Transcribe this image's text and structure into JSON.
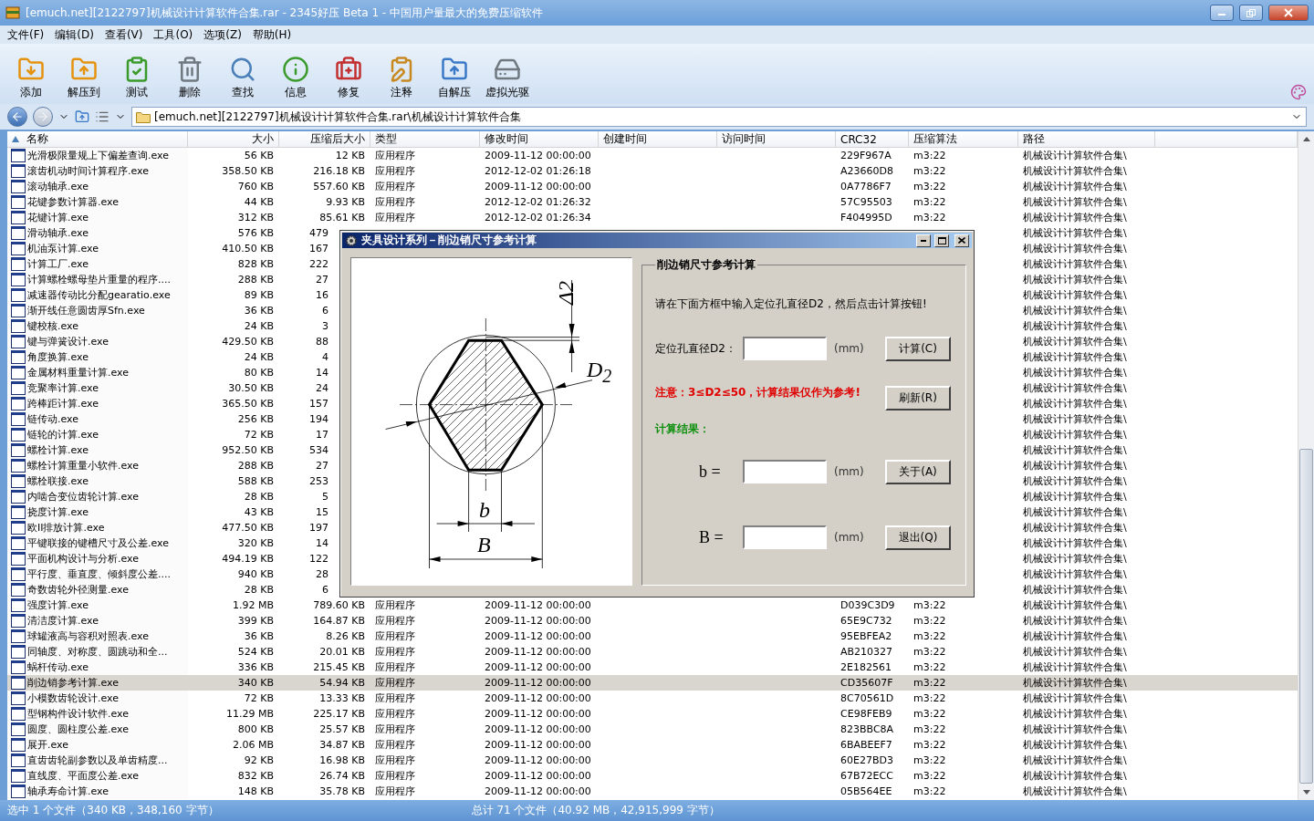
{
  "window": {
    "title": "[emuch.net][2122797]机械设计计算软件合集.rar - 2345好压 Beta 1 - 中国用户量最大的免费压缩软件"
  },
  "menu": [
    "文件(F)",
    "编辑(D)",
    "查看(V)",
    "工具(O)",
    "选项(Z)",
    "帮助(H)"
  ],
  "toolbar": [
    {
      "label": "添加",
      "kind": "add"
    },
    {
      "label": "解压到",
      "kind": "extract"
    },
    {
      "label": "测试",
      "kind": "test"
    },
    {
      "label": "删除",
      "kind": "delete"
    },
    {
      "label": "查找",
      "kind": "find"
    },
    {
      "label": "信息",
      "kind": "info"
    },
    {
      "label": "修复",
      "kind": "repair"
    },
    {
      "label": "注释",
      "kind": "comment"
    },
    {
      "label": "自解压",
      "kind": "sfx"
    },
    {
      "label": "虚拟光驱",
      "kind": "drive"
    }
  ],
  "address": {
    "path": "[emuch.net][2122797]机械设计计算软件合集.rar\\机械设计计算软件合集",
    "forward_disabled": true
  },
  "table": {
    "columns": [
      {
        "label": "名称",
        "sorted": true
      },
      {
        "label": "大小",
        "sorted": false
      },
      {
        "label": "压缩后大小",
        "sorted": false
      },
      {
        "label": "类型",
        "sorted": false
      },
      {
        "label": "修改时间",
        "sorted": false
      },
      {
        "label": "创建时间",
        "sorted": false
      },
      {
        "label": "访问时间",
        "sorted": false
      },
      {
        "label": "CRC32",
        "sorted": false
      },
      {
        "label": "压缩算法",
        "sorted": false
      },
      {
        "label": "路径",
        "sorted": false
      }
    ],
    "rows": [
      {
        "name": "光滑极限量规上下偏差查询.exe",
        "size": "56 KB",
        "compressed": "12 KB",
        "type": "应用程序",
        "modified": "2009-11-12 00:00:00",
        "crc": "229F967A",
        "method": "m3:22",
        "path": "机械设计计算软件合集\\",
        "selected": false
      },
      {
        "name": "滚齿机动时间计算程序.exe",
        "size": "358.50 KB",
        "compressed": "216.18 KB",
        "type": "应用程序",
        "modified": "2012-12-02 01:26:18",
        "crc": "A23660D8",
        "method": "m3:22",
        "path": "机械设计计算软件合集\\",
        "selected": false
      },
      {
        "name": "滚动轴承.exe",
        "size": "760 KB",
        "compressed": "557.60 KB",
        "type": "应用程序",
        "modified": "2009-11-12 00:00:00",
        "crc": "0A7786F7",
        "method": "m3:22",
        "path": "机械设计计算软件合集\\",
        "selected": false
      },
      {
        "name": "花键参数计算器.exe",
        "size": "44 KB",
        "compressed": "9.93 KB",
        "type": "应用程序",
        "modified": "2012-12-02 01:26:32",
        "crc": "57C95503",
        "method": "m3:22",
        "path": "机械设计计算软件合集\\",
        "selected": false
      },
      {
        "name": "花键计算.exe",
        "size": "312 KB",
        "compressed": "85.61 KB",
        "type": "应用程序",
        "modified": "2012-12-02 01:26:34",
        "crc": "F404995D",
        "method": "m3:22",
        "path": "机械设计计算软件合集\\",
        "selected": false
      },
      {
        "name": "滑动轴承.exe",
        "size": "576 KB",
        "compressed": "479",
        "path": "机械设计计算软件合集\\",
        "selected": false
      },
      {
        "name": "机油泵计算.exe",
        "size": "410.50 KB",
        "compressed": "167",
        "path": "机械设计计算软件合集\\",
        "selected": false
      },
      {
        "name": "计算工厂.exe",
        "size": "828 KB",
        "compressed": "222",
        "path": "机械设计计算软件合集\\",
        "selected": false
      },
      {
        "name": "计算螺栓螺母垫片重量的程序....",
        "size": "288 KB",
        "compressed": "27",
        "path": "机械设计计算软件合集\\",
        "selected": false
      },
      {
        "name": "减速器传动比分配gearatio.exe",
        "size": "89 KB",
        "compressed": "16",
        "path": "机械设计计算软件合集\\",
        "selected": false
      },
      {
        "name": "渐开线任意圆齿厚Sfn.exe",
        "size": "36 KB",
        "compressed": "6",
        "path": "机械设计计算软件合集\\",
        "selected": false
      },
      {
        "name": "键校核.exe",
        "size": "24 KB",
        "compressed": "3",
        "path": "机械设计计算软件合集\\",
        "selected": false
      },
      {
        "name": "键与弹簧设计.exe",
        "size": "429.50 KB",
        "compressed": "88",
        "path": "机械设计计算软件合集\\",
        "selected": false
      },
      {
        "name": "角度换算.exe",
        "size": "24 KB",
        "compressed": "4",
        "path": "机械设计计算软件合集\\",
        "selected": false
      },
      {
        "name": "金属材料重量计算.exe",
        "size": "80 KB",
        "compressed": "14",
        "path": "机械设计计算软件合集\\",
        "selected": false
      },
      {
        "name": "竞聚率计算.exe",
        "size": "30.50 KB",
        "compressed": "24",
        "path": "机械设计计算软件合集\\",
        "selected": false
      },
      {
        "name": "跨棒距计算.exe",
        "size": "365.50 KB",
        "compressed": "157",
        "path": "机械设计计算软件合集\\",
        "selected": false
      },
      {
        "name": "链传动.exe",
        "size": "256 KB",
        "compressed": "194",
        "path": "机械设计计算软件合集\\",
        "selected": false
      },
      {
        "name": "链轮的计算.exe",
        "size": "72 KB",
        "compressed": "17",
        "path": "机械设计计算软件合集\\",
        "selected": false
      },
      {
        "name": "螺栓计算.exe",
        "size": "952.50 KB",
        "compressed": "534",
        "path": "机械设计计算软件合集\\",
        "selected": false
      },
      {
        "name": "螺栓计算重量小软件.exe",
        "size": "288 KB",
        "compressed": "27",
        "path": "机械设计计算软件合集\\",
        "selected": false
      },
      {
        "name": "螺栓联接.exe",
        "size": "588 KB",
        "compressed": "253",
        "path": "机械设计计算软件合集\\",
        "selected": false
      },
      {
        "name": "内啮合变位齿轮计算.exe",
        "size": "28 KB",
        "compressed": "5",
        "path": "机械设计计算软件合集\\",
        "selected": false
      },
      {
        "name": "挠度计算.exe",
        "size": "43 KB",
        "compressed": "15",
        "path": "机械设计计算软件合集\\",
        "selected": false
      },
      {
        "name": "欧II排放计算.exe",
        "size": "477.50 KB",
        "compressed": "197",
        "path": "机械设计计算软件合集\\",
        "selected": false
      },
      {
        "name": "平键联接的键槽尺寸及公差.exe",
        "size": "320 KB",
        "compressed": "14",
        "path": "机械设计计算软件合集\\",
        "selected": false
      },
      {
        "name": "平面机构设计与分析.exe",
        "size": "494.19 KB",
        "compressed": "122",
        "path": "机械设计计算软件合集\\",
        "selected": false
      },
      {
        "name": "平行度、垂直度、倾斜度公差....",
        "size": "940 KB",
        "compressed": "28",
        "path": "机械设计计算软件合集\\",
        "selected": false
      },
      {
        "name": "奇数齿轮外径测量.exe",
        "size": "28 KB",
        "compressed": "6",
        "path": "机械设计计算软件合集\\",
        "selected": false
      },
      {
        "name": "强度计算.exe",
        "size": "1.92 MB",
        "compressed": "789.60 KB",
        "type": "应用程序",
        "modified": "2009-11-12 00:00:00",
        "crc": "D039C3D9",
        "method": "m3:22",
        "path": "机械设计计算软件合集\\",
        "selected": false
      },
      {
        "name": "清洁度计算.exe",
        "size": "399 KB",
        "compressed": "164.87 KB",
        "type": "应用程序",
        "modified": "2009-11-12 00:00:00",
        "crc": "65E9C732",
        "method": "m3:22",
        "path": "机械设计计算软件合集\\",
        "selected": false
      },
      {
        "name": "球罐液高与容积对照表.exe",
        "size": "36 KB",
        "compressed": "8.26 KB",
        "type": "应用程序",
        "modified": "2009-11-12 00:00:00",
        "crc": "95EBFEA2",
        "method": "m3:22",
        "path": "机械设计计算软件合集\\",
        "selected": false
      },
      {
        "name": "同轴度、对称度、圆跳动和全...",
        "size": "524 KB",
        "compressed": "20.01 KB",
        "type": "应用程序",
        "modified": "2009-11-12 00:00:00",
        "crc": "AB210327",
        "method": "m3:22",
        "path": "机械设计计算软件合集\\",
        "selected": false
      },
      {
        "name": "蜗杆传动.exe",
        "size": "336 KB",
        "compressed": "215.45 KB",
        "type": "应用程序",
        "modified": "2009-11-12 00:00:00",
        "crc": "2E182561",
        "method": "m3:22",
        "path": "机械设计计算软件合集\\",
        "selected": false
      },
      {
        "name": "削边销参考计算.exe",
        "size": "340 KB",
        "compressed": "54.94 KB",
        "type": "应用程序",
        "modified": "2009-11-12 00:00:00",
        "crc": "CD35607F",
        "method": "m3:22",
        "path": "机械设计计算软件合集\\",
        "selected": true
      },
      {
        "name": "小模数齿轮设计.exe",
        "size": "72 KB",
        "compressed": "13.33 KB",
        "type": "应用程序",
        "modified": "2009-11-12 00:00:00",
        "crc": "8C70561D",
        "method": "m3:22",
        "path": "机械设计计算软件合集\\",
        "selected": false
      },
      {
        "name": "型钢构件设计软件.exe",
        "size": "11.29 MB",
        "compressed": "225.17 KB",
        "type": "应用程序",
        "modified": "2009-11-12 00:00:00",
        "crc": "CE98FEB9",
        "method": "m3:22",
        "path": "机械设计计算软件合集\\",
        "selected": false
      },
      {
        "name": "圆度、圆柱度公差.exe",
        "size": "800 KB",
        "compressed": "25.57 KB",
        "type": "应用程序",
        "modified": "2009-11-12 00:00:00",
        "crc": "823BBC8A",
        "method": "m3:22",
        "path": "机械设计计算软件合集\\",
        "selected": false
      },
      {
        "name": "展开.exe",
        "size": "2.06 MB",
        "compressed": "34.87 KB",
        "type": "应用程序",
        "modified": "2009-11-12 00:00:00",
        "crc": "6BABEEF7",
        "method": "m3:22",
        "path": "机械设计计算软件合集\\",
        "selected": false
      },
      {
        "name": "直齿齿轮副参数以及单齿精度...",
        "size": "92 KB",
        "compressed": "16.98 KB",
        "type": "应用程序",
        "modified": "2009-11-12 00:00:00",
        "crc": "60E27BD3",
        "method": "m3:22",
        "path": "机械设计计算软件合集\\",
        "selected": false
      },
      {
        "name": "直线度、平面度公差.exe",
        "size": "832 KB",
        "compressed": "26.74 KB",
        "type": "应用程序",
        "modified": "2009-11-12 00:00:00",
        "crc": "67B72ECC",
        "method": "m3:22",
        "path": "机械设计计算软件合集\\",
        "selected": false
      },
      {
        "name": "轴承寿命计算.exe",
        "size": "148 KB",
        "compressed": "35.78 KB",
        "type": "应用程序",
        "modified": "2009-11-12 00:00:00",
        "crc": "05B564EE",
        "method": "m3:22",
        "path": "机械设计计算软件合集\\",
        "selected": false
      }
    ]
  },
  "dialog": {
    "title": "夹具设计系列－削边销尺寸参考计算",
    "diagram": {
      "labels": [
        "Δ2",
        "D$_{2}$",
        "b",
        "B"
      ]
    },
    "group_title": "削边销尺寸参考计算",
    "instruction": "请在下面方框中输入定位孔直径D2，然后点击计算按钮!",
    "input_label": "定位孔直径D2：",
    "unit": "(mm)",
    "warning": "注意：3≤D2≤50，计算结果仅作为参考!",
    "result_title": "计算结果：",
    "results": [
      {
        "label": "b =",
        "unit": "(mm)"
      },
      {
        "label": "B =",
        "unit": "(mm)"
      }
    ],
    "buttons": [
      "计算(C)",
      "刷新(R)",
      "关于(A)",
      "退出(Q)"
    ]
  },
  "status_bar": {
    "left": "选中 1 个文件（340 KB，348,160 字节）",
    "right": "总计 71 个文件（40.92 MB，42,915,999 字节）"
  }
}
